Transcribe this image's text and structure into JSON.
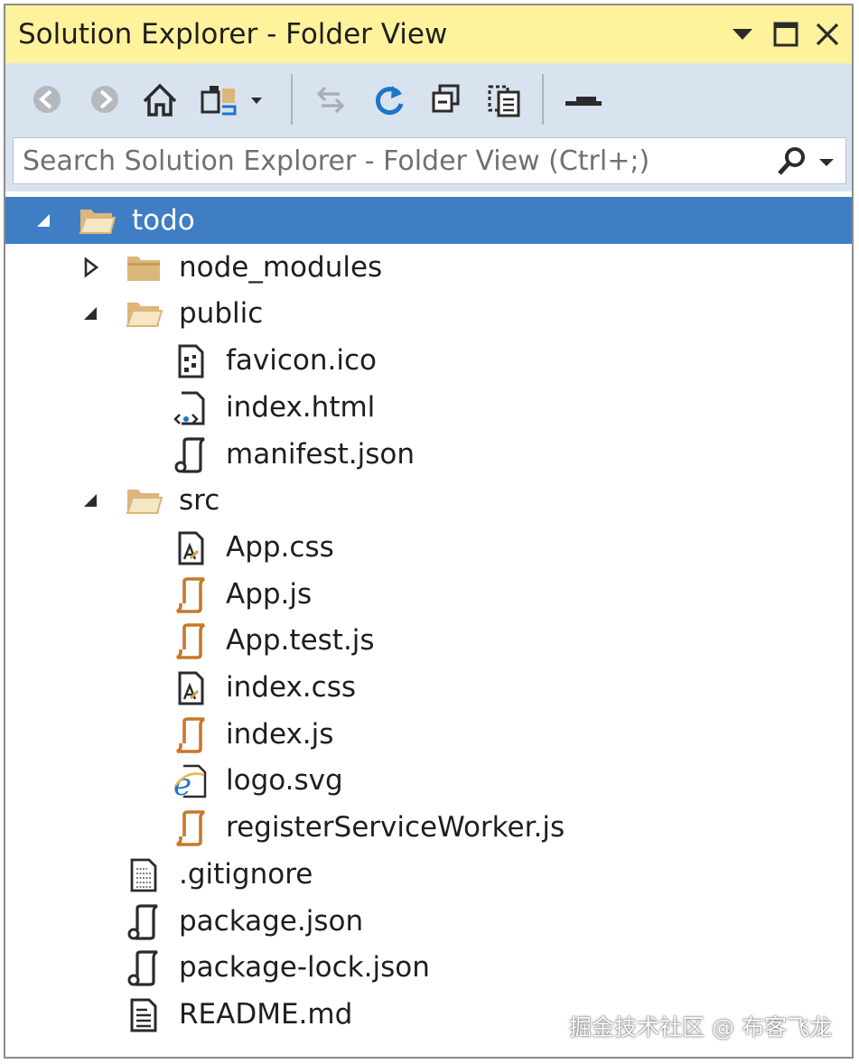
{
  "window": {
    "title": "Solution Explorer - Folder View",
    "title_buttons": [
      {
        "name": "dropdown-arrow-icon"
      },
      {
        "name": "maximize-icon"
      },
      {
        "name": "close-icon"
      }
    ]
  },
  "toolbar": {
    "buttons": [
      {
        "name": "back-button",
        "icon": "arrow-left-circle-icon",
        "enabled": false
      },
      {
        "name": "forward-button",
        "icon": "arrow-right-circle-icon",
        "enabled": false
      },
      {
        "name": "home-button",
        "icon": "home-icon",
        "enabled": true
      },
      {
        "name": "switch-views-button",
        "icon": "switch-views-icon",
        "enabled": true
      },
      {
        "name": "sync-button",
        "icon": "sync-arrows-icon",
        "enabled": false
      },
      {
        "name": "refresh-button",
        "icon": "refresh-icon",
        "enabled": true
      },
      {
        "name": "collapse-all-button",
        "icon": "collapse-all-icon",
        "enabled": true
      },
      {
        "name": "show-all-files-button",
        "icon": "show-all-files-icon",
        "enabled": true
      },
      {
        "name": "properties-button",
        "icon": "properties-icon",
        "enabled": true
      }
    ]
  },
  "search": {
    "placeholder": "Search Solution Explorer - Folder View (Ctrl+;)"
  },
  "tree": {
    "items": [
      {
        "label": "todo",
        "level": 0,
        "type": "folder-open",
        "expander": "expanded",
        "selected": true
      },
      {
        "label": "node_modules",
        "level": 1,
        "type": "folder-closed",
        "expander": "collapsed"
      },
      {
        "label": "public",
        "level": 1,
        "type": "folder-open",
        "expander": "expanded"
      },
      {
        "label": "favicon.ico",
        "level": 2,
        "type": "ico-file"
      },
      {
        "label": "index.html",
        "level": 2,
        "type": "html-file"
      },
      {
        "label": "manifest.json",
        "level": 2,
        "type": "json-file"
      },
      {
        "label": "src",
        "level": 1,
        "type": "folder-open",
        "expander": "expanded"
      },
      {
        "label": "App.css",
        "level": 2,
        "type": "css-file"
      },
      {
        "label": "App.js",
        "level": 2,
        "type": "js-file"
      },
      {
        "label": "App.test.js",
        "level": 2,
        "type": "js-file"
      },
      {
        "label": "index.css",
        "level": 2,
        "type": "css-file"
      },
      {
        "label": "index.js",
        "level": 2,
        "type": "js-file"
      },
      {
        "label": "logo.svg",
        "level": 2,
        "type": "svg-file"
      },
      {
        "label": "registerServiceWorker.js",
        "level": 2,
        "type": "js-file"
      },
      {
        "label": ".gitignore",
        "level": 1,
        "type": "text-file"
      },
      {
        "label": "package.json",
        "level": 1,
        "type": "json-file"
      },
      {
        "label": "package-lock.json",
        "level": 1,
        "type": "json-file"
      },
      {
        "label": "README.md",
        "level": 1,
        "type": "markdown-file"
      }
    ]
  },
  "colors": {
    "title_bar": "#fff29d",
    "toolbar": "#d9e3f0",
    "selection": "#3f7ec4",
    "folder": "#dcb67a",
    "js_icon": "#c8782a",
    "ie_blue": "#1e74c8"
  },
  "watermark": "掘金技术社区 @ 布客飞龙"
}
